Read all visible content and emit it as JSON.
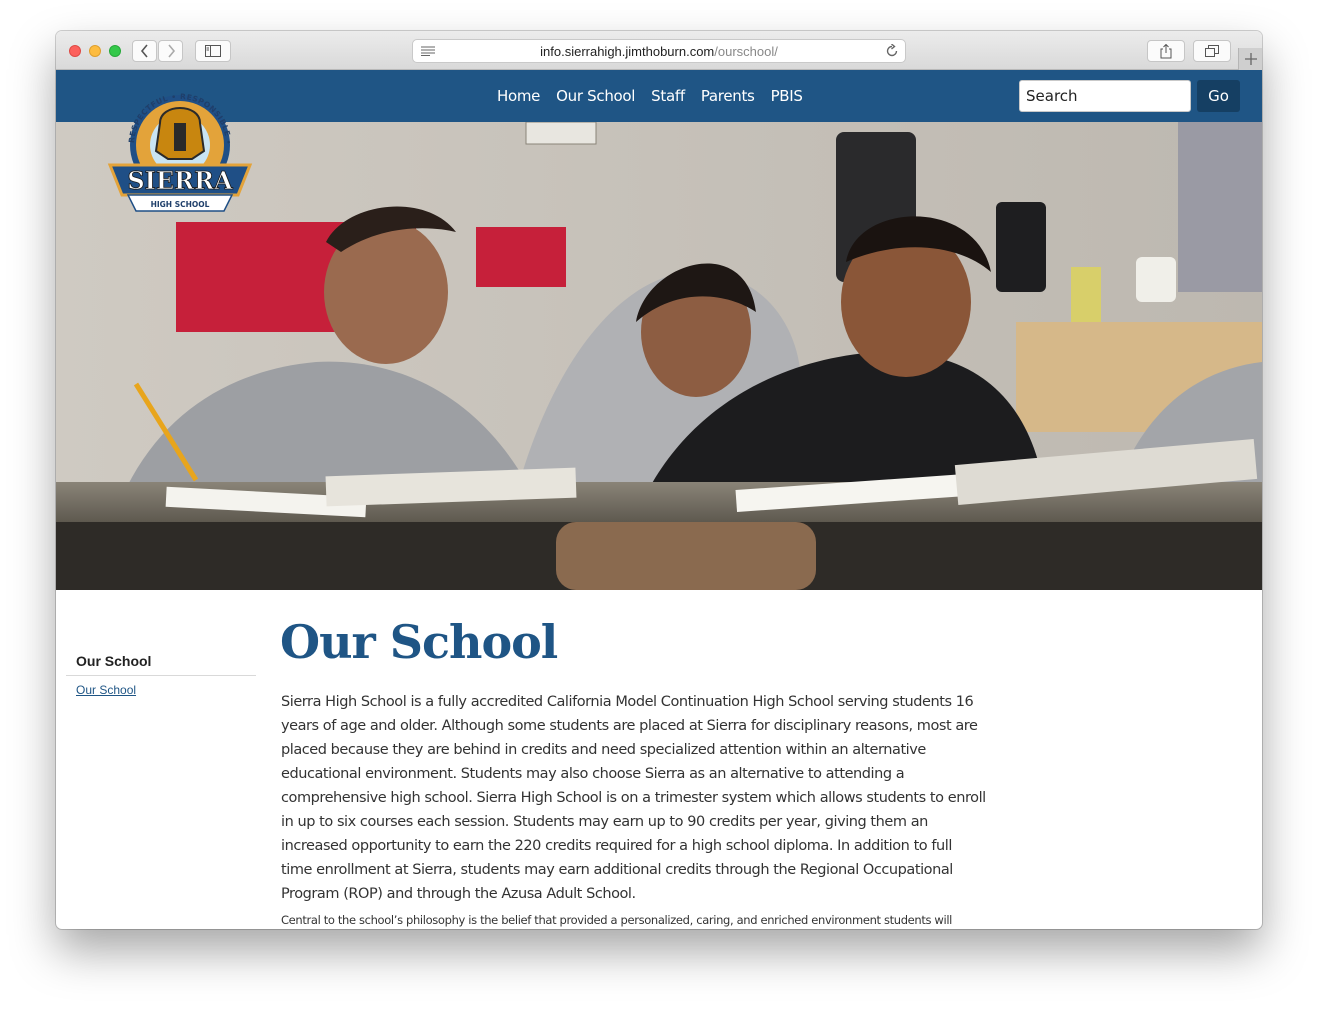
{
  "browser": {
    "url_host": "info.sierrahigh.jimthoburn.com",
    "url_path": "/ourschool/"
  },
  "nav": {
    "items": [
      "Home",
      "Our School",
      "Staff",
      "Parents",
      "PBIS"
    ],
    "search_placeholder": "Search",
    "go_label": "Go"
  },
  "logo": {
    "name": "SIERRA",
    "subtitle": "HIGH SCHOOL",
    "motto": "RESPECTFUL • RESPONSIBLE • READY"
  },
  "sidebar": {
    "heading": "Our School",
    "links": [
      "Our School"
    ]
  },
  "main": {
    "title": "Our School",
    "paragraph_1": "Sierra High School is a fully accredited California Model Continuation High School serving students 16 years of age and older. Although some students are placed at Sierra for disciplinary reasons, most are placed because they are behind in credits and need specialized attention within an alternative educational environment.  Students may also choose Sierra as an alternative to attending a comprehensive high school.  Sierra High School is on a trimester system which allows students to enroll in up to six courses each session.  Students may earn up to 90 credits per year, giving them an increased opportunity to earn the 220 credits required for a high school diploma.  In addition to full time enrollment at Sierra, students may earn additional credits through the Regional Occupational Program (ROP) and through the Azusa Adult School.",
    "paragraph_2": "Central to the school’s philosophy is the belief that provided a personalized, caring, and enriched environment students will"
  },
  "colors": {
    "brand_blue": "#1f5585",
    "go_button": "#153f63"
  }
}
